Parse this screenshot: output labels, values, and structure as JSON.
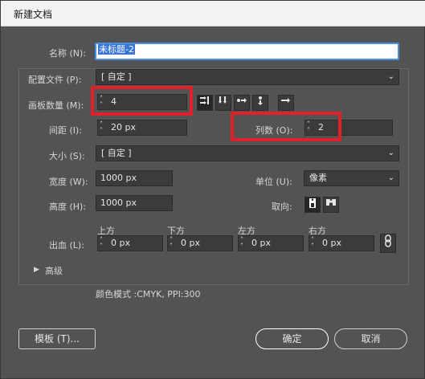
{
  "window": {
    "title": "新建文档"
  },
  "name": {
    "label": "名称 (N):",
    "value": "未标题-2"
  },
  "profile": {
    "label": "配置文件 (P):",
    "value": "[ 自定 ]"
  },
  "artboards": {
    "label": "画板数量 (M):",
    "value": "4"
  },
  "spacing": {
    "label": "间距 (I):",
    "value": "20 px"
  },
  "columns": {
    "label": "列数 (O):",
    "value": "2"
  },
  "size": {
    "label": "大小 (S):",
    "value": "[ 自定 ]"
  },
  "width": {
    "label": "宽度 (W):",
    "value": "1000 px"
  },
  "units": {
    "label": "单位 (U):",
    "value": "像素"
  },
  "height": {
    "label": "高度 (H):",
    "value": "1000 px"
  },
  "orientation": {
    "label": "取向:"
  },
  "bleed": {
    "label": "出血 (L):",
    "top": {
      "label": "上方",
      "value": "0 px"
    },
    "bottom": {
      "label": "下方",
      "value": "0 px"
    },
    "left": {
      "label": "左方",
      "value": "0 px"
    },
    "right": {
      "label": "右方",
      "value": "0 px"
    }
  },
  "advanced": {
    "label": "高级"
  },
  "color_info": "颜色模式 :CMYK, PPI:300",
  "buttons": {
    "templates": "模板 (T)...",
    "ok": "确定",
    "cancel": "取消"
  },
  "colors": {
    "dialog_bg": "#535353",
    "highlight": "#e0202a",
    "selection": "#3875d7"
  },
  "icons": [
    "grid-by-row-icon",
    "grid-by-column-icon",
    "arrange-by-row-icon",
    "arrange-by-column-icon",
    "right-to-left-icon",
    "portrait-icon",
    "landscape-icon",
    "link-icon",
    "chevron-down-icon"
  ]
}
